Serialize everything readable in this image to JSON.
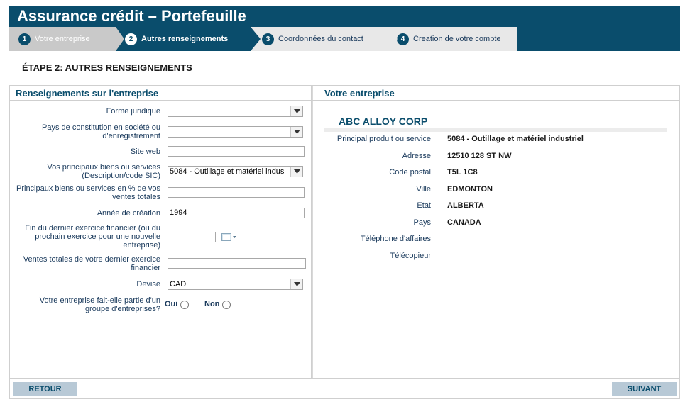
{
  "header": {
    "title": "Assurance crédit – Portefeuille"
  },
  "steps": [
    {
      "num": "1",
      "label": "Votre entreprise"
    },
    {
      "num": "2",
      "label": "Autres renseignements"
    },
    {
      "num": "3",
      "label": "Coordonnées du contact"
    },
    {
      "num": "4",
      "label": "Creation de votre compte"
    }
  ],
  "colors": {
    "brand": "#0a4d6c",
    "inactive_step": "#c9c9c9",
    "button_bg": "#b8c9d6"
  },
  "stage_title": "ÉTAPE 2: AUTRES RENSEIGNEMENTS",
  "form": {
    "heading": "Renseignements sur l'entreprise",
    "forme_juridique": {
      "label": "Forme juridique",
      "value": ""
    },
    "pays_constitution": {
      "label": "Pays de constitution en société ou d'enregistrement",
      "value": ""
    },
    "site_web": {
      "label": "Site web",
      "value": ""
    },
    "biens_services": {
      "label": "Vos principaux biens ou services (Description/code SIC)",
      "value": "5084 - Outillage et matériel indus"
    },
    "pct_ventes": {
      "label": "Principaux biens ou services en % de vos ventes totales",
      "value": ""
    },
    "annee_creation": {
      "label": "Année de création",
      "value": "1994"
    },
    "fin_exercice": {
      "label": "Fin du dernier exercice financier (ou du prochain exercice pour une nouvelle entreprise)",
      "value": ""
    },
    "ventes_totales": {
      "label": "Ventes totales de votre dernier exercice financier",
      "value": ""
    },
    "devise": {
      "label": "Devise",
      "value": "CAD"
    },
    "groupe": {
      "label": "Votre entreprise fait-elle partie d'un groupe d'entreprises?",
      "oui": "Oui",
      "non": "Non"
    }
  },
  "company": {
    "heading": "Votre entreprise",
    "name": "ABC ALLOY CORP",
    "fields": [
      {
        "label": "Principal produit ou service",
        "value": "5084 - Outillage et matériel industriel"
      },
      {
        "label": "Adresse",
        "value": "12510 128 ST NW"
      },
      {
        "label": "Code postal",
        "value": "T5L 1C8"
      },
      {
        "label": "Ville",
        "value": "EDMONTON"
      },
      {
        "label": "Etat",
        "value": "ALBERTA"
      },
      {
        "label": "Pays",
        "value": "CANADA"
      },
      {
        "label": "Téléphone d'affaires",
        "value": ""
      },
      {
        "label": "Télécopieur",
        "value": ""
      }
    ]
  },
  "buttons": {
    "back": "RETOUR",
    "next": "SUIVANT"
  }
}
